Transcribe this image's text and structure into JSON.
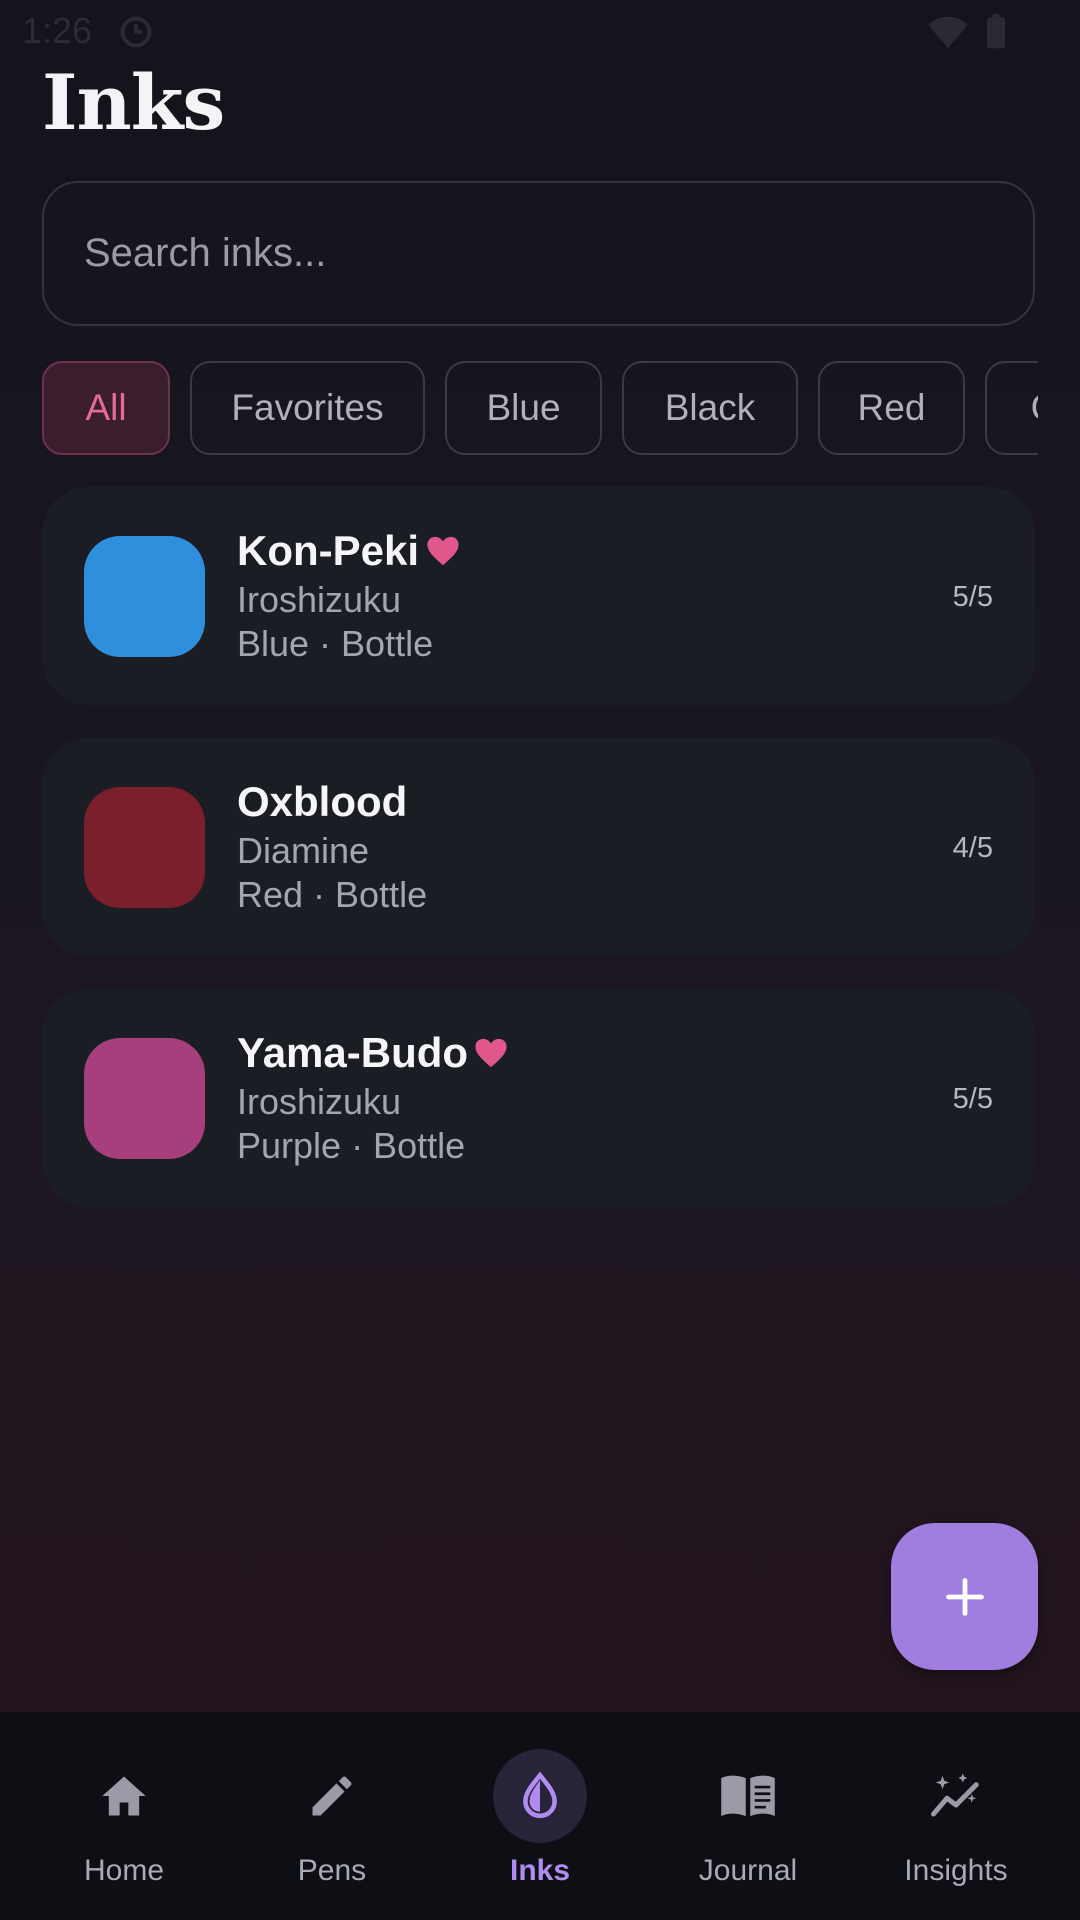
{
  "status": {
    "time": "1:26"
  },
  "header": {
    "title": "Inks"
  },
  "search": {
    "placeholder": "Search inks..."
  },
  "filters": [
    "All",
    "Favorites",
    "Blue",
    "Black",
    "Red",
    "G"
  ],
  "inks": [
    {
      "name": "Kon-Peki",
      "brand": "Iroshizuku",
      "meta": "Blue · Bottle",
      "rating": "5/5",
      "favorite": true,
      "swatch": "#2f8fdc"
    },
    {
      "name": "Oxblood",
      "brand": "Diamine",
      "meta": "Red · Bottle",
      "rating": "4/5",
      "favorite": false,
      "swatch": "#7a1f2b"
    },
    {
      "name": "Yama-Budo",
      "brand": "Iroshizuku",
      "meta": "Purple · Bottle",
      "rating": "5/5",
      "favorite": true,
      "swatch": "#a63f7c"
    }
  ],
  "colors": {
    "accent": "#a07ee0",
    "heart": "#e0578c",
    "chip_active": "#e46a9a"
  },
  "nav": [
    {
      "label": "Home",
      "icon": "home-icon"
    },
    {
      "label": "Pens",
      "icon": "pencil-icon"
    },
    {
      "label": "Inks",
      "icon": "ink-drop-icon"
    },
    {
      "label": "Journal",
      "icon": "journal-icon"
    },
    {
      "label": "Insights",
      "icon": "insights-icon"
    }
  ]
}
